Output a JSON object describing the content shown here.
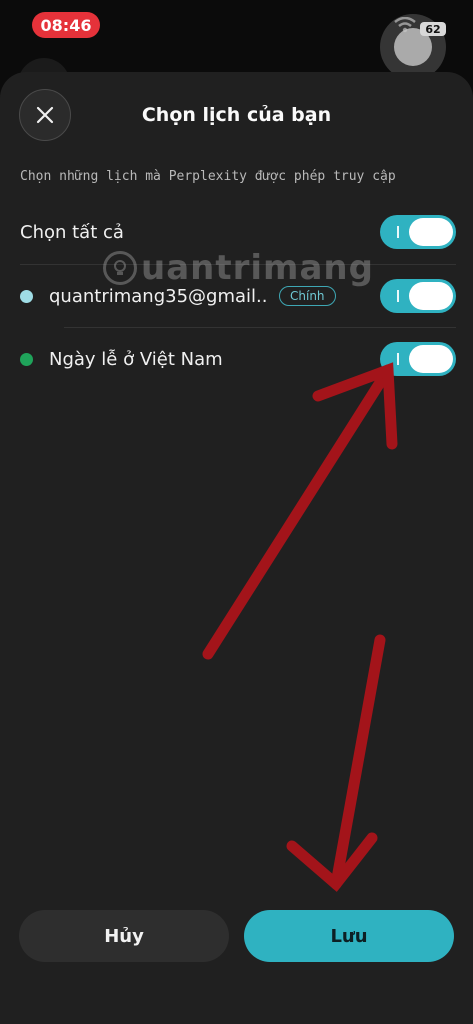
{
  "status_bar": {
    "time": "08:46",
    "battery": "62"
  },
  "sheet": {
    "title": "Chọn lịch của bạn",
    "subtitle": "Chọn những lịch mà Perplexity được phép truy cập"
  },
  "calendars": {
    "select_all_label": "Chọn tất cả",
    "items": [
      {
        "label": "quantrimang35@gmail...",
        "badge": "Chính",
        "dot_color": "#9fdde6",
        "enabled": true
      },
      {
        "label": "Ngày lễ ở Việt Nam",
        "badge": "",
        "dot_color": "#1fa35a",
        "enabled": true
      }
    ]
  },
  "watermark": {
    "text": "uantrimang"
  },
  "buttons": {
    "cancel": "Hủy",
    "save": "Lưu"
  },
  "colors": {
    "accent": "#2fb2c1",
    "annotation_arrow": "#a3141a",
    "time_pill": "#e5323a"
  },
  "icons": [
    "close-icon",
    "wifi-icon",
    "toggle-on"
  ]
}
